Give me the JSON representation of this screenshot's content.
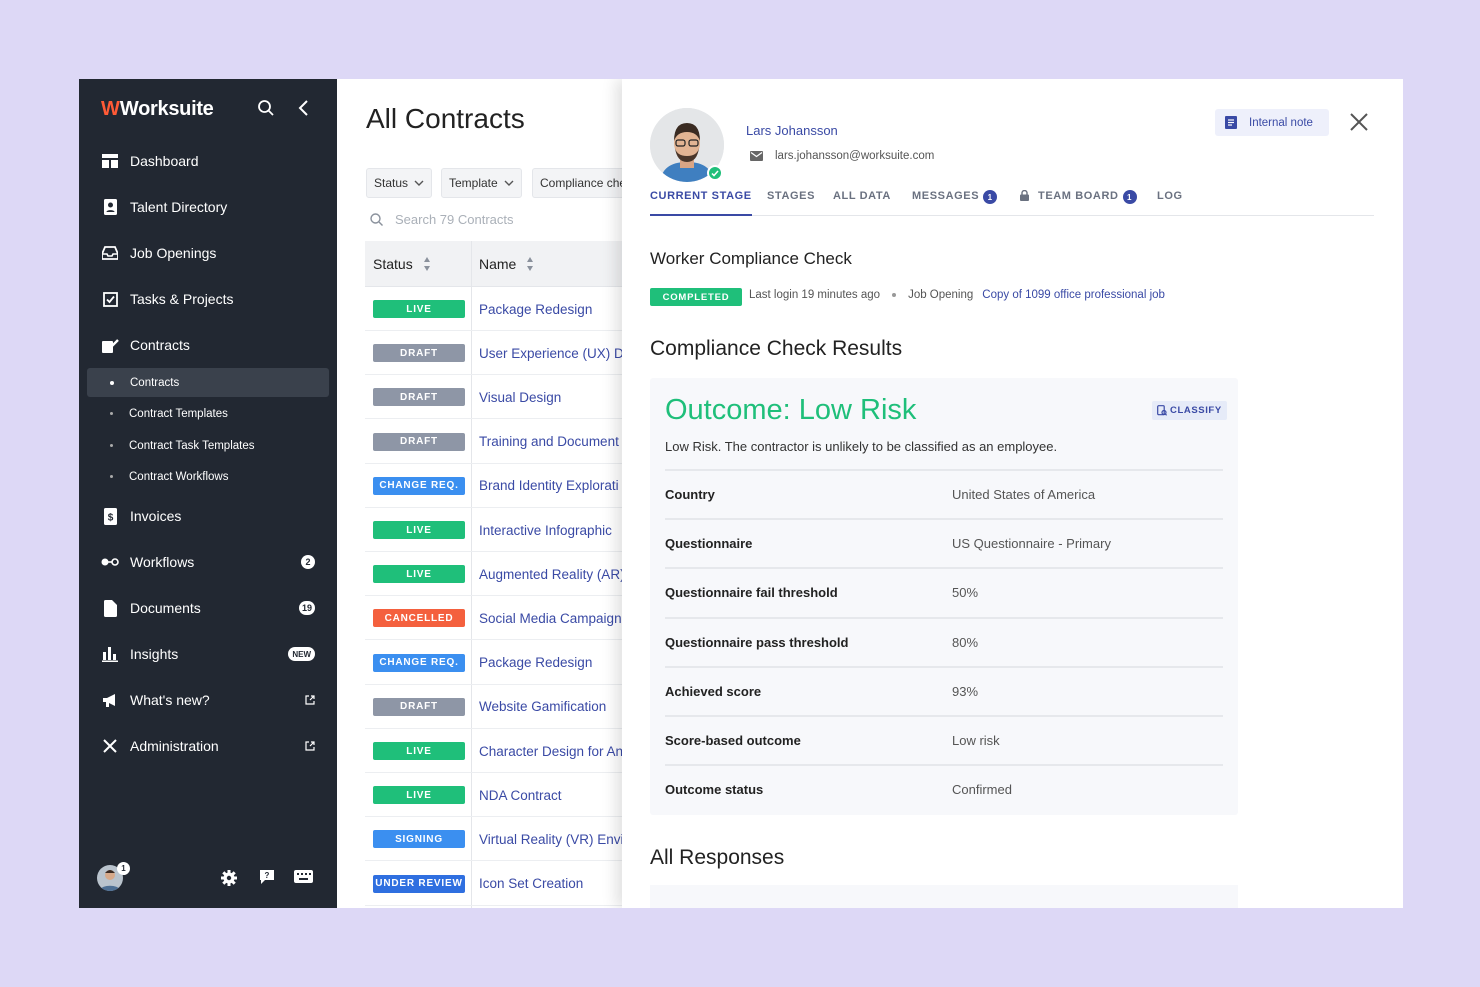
{
  "sidebar": {
    "brand": "Worksuite",
    "nav": [
      {
        "label": "Dashboard",
        "icon": "dashboard-icon"
      },
      {
        "label": "Talent Directory",
        "icon": "contacts-icon"
      },
      {
        "label": "Job Openings",
        "icon": "inbox-icon"
      },
      {
        "label": "Tasks & Projects",
        "icon": "checkbox-icon"
      },
      {
        "label": "Contracts",
        "icon": "signature-icon"
      }
    ],
    "sub": [
      {
        "label": "Contracts",
        "active": true
      },
      {
        "label": "Contract Templates"
      },
      {
        "label": "Contract Task Templates"
      },
      {
        "label": "Contract Workflows"
      }
    ],
    "nav2": [
      {
        "label": "Invoices",
        "icon": "invoice-icon"
      },
      {
        "label": "Workflows",
        "icon": "workflow-icon",
        "badge": "2"
      },
      {
        "label": "Documents",
        "icon": "document-icon",
        "badge": "19"
      },
      {
        "label": "Insights",
        "icon": "bar-chart-icon",
        "badge": "NEW"
      },
      {
        "label": "What's new?",
        "icon": "megaphone-icon"
      },
      {
        "label": "Administration",
        "icon": "tools-icon"
      }
    ],
    "avatar_badge": "1"
  },
  "contracts": {
    "title": "All Contracts",
    "filters": [
      "Status",
      "Template",
      "Compliance che"
    ],
    "search_placeholder": "Search 79 Contracts",
    "columns": [
      "Status",
      "Name"
    ],
    "rows": [
      {
        "status": "LIVE",
        "color": "#1fbf7a",
        "name": "Package Redesign"
      },
      {
        "status": "DRAFT",
        "color": "#8e96a6",
        "name": "User Experience (UX) De"
      },
      {
        "status": "DRAFT",
        "color": "#8e96a6",
        "name": "Visual Design"
      },
      {
        "status": "DRAFT",
        "color": "#8e96a6",
        "name": "Training and Document"
      },
      {
        "status": "CHANGE REQ.",
        "color": "#3b8ff0",
        "name": "Brand Identity Explorati"
      },
      {
        "status": "LIVE",
        "color": "#1fbf7a",
        "name": "Interactive Infographic"
      },
      {
        "status": "LIVE",
        "color": "#1fbf7a",
        "name": "Augmented Reality (AR)"
      },
      {
        "status": "CANCELLED",
        "color": "#f4603e",
        "name": "Social Media Campaign"
      },
      {
        "status": "CHANGE REQ.",
        "color": "#3b8ff0",
        "name": "Package Redesign"
      },
      {
        "status": "DRAFT",
        "color": "#8e96a6",
        "name": "Website Gamification"
      },
      {
        "status": "LIVE",
        "color": "#1fbf7a",
        "name": "Character Design for An"
      },
      {
        "status": "LIVE",
        "color": "#1fbf7a",
        "name": "NDA Contract"
      },
      {
        "status": "SIGNING",
        "color": "#3b8ff0",
        "name": "Virtual Reality (VR) Envir"
      },
      {
        "status": "UNDER REVIEW",
        "color": "#2f6fe0",
        "name": "Icon Set Creation"
      }
    ]
  },
  "panel": {
    "name": "Lars Johansson",
    "email": "lars.johansson@worksuite.com",
    "internal_note": "Internal note",
    "tabs": [
      {
        "label": "CURRENT STAGE",
        "active": true
      },
      {
        "label": "STAGES"
      },
      {
        "label": "ALL DATA"
      },
      {
        "label": "MESSAGES",
        "badge": "1"
      },
      {
        "label": "TEAM BOARD",
        "badge": "1",
        "locked": true
      },
      {
        "label": "LOG"
      }
    ],
    "stage_title": "Worker Compliance Check",
    "stage_status": "COMPLETED",
    "last_login": "Last login 19 minutes ago",
    "job_opening_label": "Job Opening",
    "job_opening_link": "Copy of 1099 office professional job",
    "results_title": "Compliance Check Results",
    "outcome": "Outcome: Low Risk",
    "classify": "CLASSIFY",
    "outcome_desc": "Low Risk. The contractor is unlikely to be classified as an employee.",
    "details": [
      {
        "k": "Country",
        "v": "United States of America"
      },
      {
        "k": "Questionnaire",
        "v": "US Questionnaire - Primary"
      },
      {
        "k": "Questionnaire fail threshold",
        "v": "50%"
      },
      {
        "k": "Questionnaire pass threshold",
        "v": "80%"
      },
      {
        "k": "Achieved score",
        "v": "93%"
      },
      {
        "k": "Score-based outcome",
        "v": "Low risk"
      },
      {
        "k": "Outcome status",
        "v": "Confirmed"
      }
    ],
    "responses_title": "All Responses"
  }
}
